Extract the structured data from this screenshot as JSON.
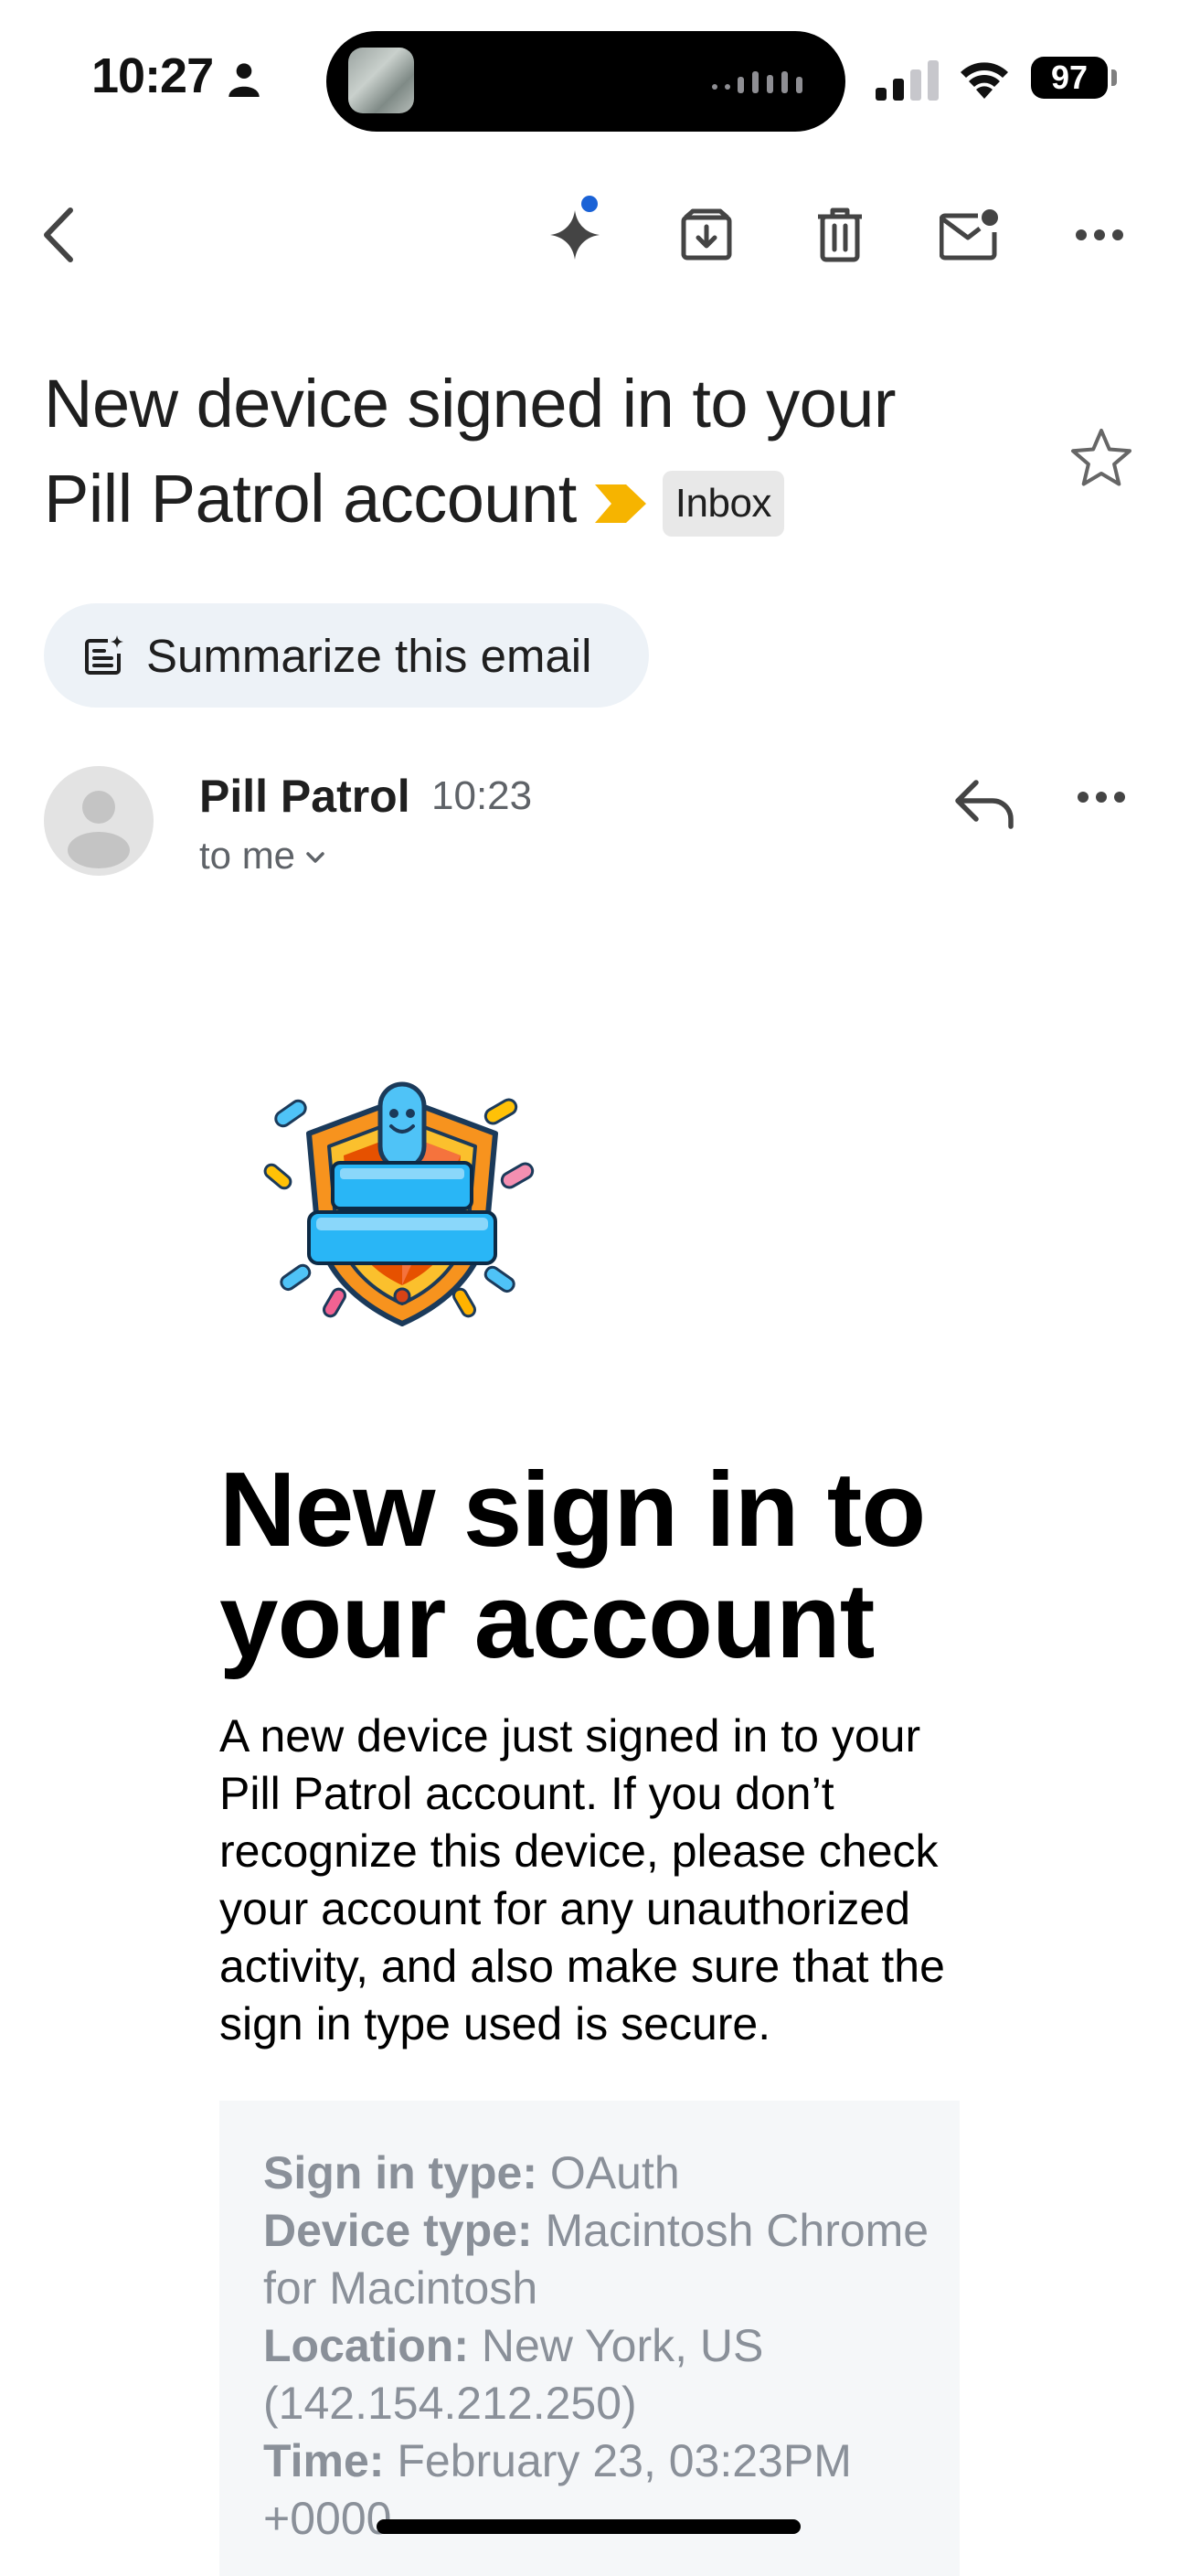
{
  "status_bar": {
    "time": "10:27",
    "battery": "97"
  },
  "toolbar": {
    "icons": [
      "back-icon",
      "gemini-icon",
      "archive-icon",
      "delete-icon",
      "mark-unread-icon",
      "more-icon"
    ]
  },
  "email": {
    "subject": "New device signed in to your Pill Patrol account",
    "label": "Inbox",
    "summarize_label": "Summarize this email",
    "sender": "Pill Patrol",
    "time": "10:23",
    "recipient": "to me",
    "body": {
      "headline": "New sign in to your account",
      "paragraph": "A new device just signed in to your Pill Patrol account. If you don’t recognize this device, please check your account for any unauthorized activity, and also make sure that the sign in type used is secure.",
      "details": {
        "sign_in_type_label": "Sign in type:",
        "sign_in_type": "OAuth",
        "device_type_label": "Device type:",
        "device_type": "Macintosh Chrome for Macintosh",
        "location_label": "Location:",
        "location": "New York, US (142.154.212.250)",
        "time_label": "Time:",
        "time": "February 23, 03:23PM +0000"
      }
    }
  },
  "colors": {
    "accent_blue": "#1a62d6",
    "importance_yellow": "#f6b400",
    "chip_bg": "#edf2f7",
    "details_text": "#8a9099"
  }
}
